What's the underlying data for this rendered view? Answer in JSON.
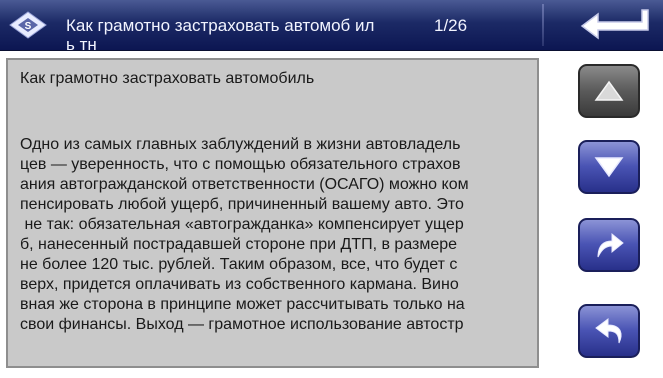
{
  "header": {
    "title": "Как грамотно застраховать автомоб иль тн",
    "page_indicator": "1/26"
  },
  "document": {
    "title": "Как грамотно застраховать автомобиль",
    "lines": [
      "Одно из самых главных заблуждений в жизни автовладель",
      "цев — уверенность, что с помощью обязательного страхов",
      "ания автогражданской ответственности (ОСАГО) можно ком",
      "пенсировать любой ущерб, причиненный вашему авто. Это",
      " не так: обязательная «автогражданка» компенсирует ущер",
      "б, нанесенный пострадавшей стороне при ДТП, в размере",
      "не более 120 тыс. рублей. Таким образом, все, что будет с",
      "верх, придется оплачивать из собственного кармана. Вино",
      "вная же сторона в принципе может рассчитывать только на",
      "свои финансы. Выход — грамотное использование автостр"
    ]
  },
  "buttons": {
    "scroll_up": "arrow-up-icon",
    "scroll_down": "arrow-down-icon",
    "forward": "curved-arrow-forward-icon",
    "back": "curved-arrow-back-icon",
    "exit": "return-arrow-icon"
  },
  "colors": {
    "header_bg": "#1c2a66",
    "panel_bg": "#c9c9c9",
    "button_blue": "#4a54b4",
    "button_gray": "#5a5a5a"
  }
}
